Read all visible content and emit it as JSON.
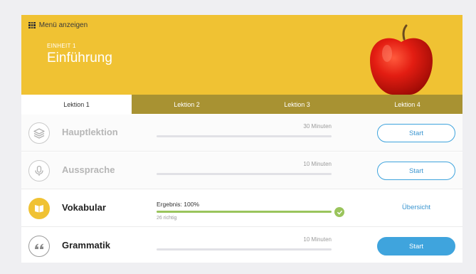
{
  "header": {
    "menu_label": "Menü anzeigen",
    "unit_label": "EINHEIT 1",
    "unit_title": "Einführung",
    "background_color": "#f0c233"
  },
  "tabs": [
    {
      "label": "Lektion 1",
      "active": true
    },
    {
      "label": "Lektion 2",
      "active": false
    },
    {
      "label": "Lektion 3",
      "active": false
    },
    {
      "label": "Lektion 4",
      "active": false
    }
  ],
  "lessons": [
    {
      "title": "Hauptlektion",
      "icon": "layers-icon",
      "duration": "30 Minuten",
      "action": "Start"
    },
    {
      "title": "Aussprache",
      "icon": "microphone-icon",
      "duration": "10 Minuten",
      "action": "Start"
    },
    {
      "title": "Vokabular",
      "icon": "book-icon",
      "result": "Ergebnis: 100%",
      "progress": 1.0,
      "sub": "26 richtig",
      "action": "Übersicht"
    },
    {
      "title": "Grammatik",
      "icon": "quote-icon",
      "duration": "10 Minuten",
      "action": "Start"
    }
  ],
  "colors": {
    "accent_blue": "#3fa4dd",
    "success_green": "#9ac45c",
    "tab_inactive": "#a89232"
  }
}
